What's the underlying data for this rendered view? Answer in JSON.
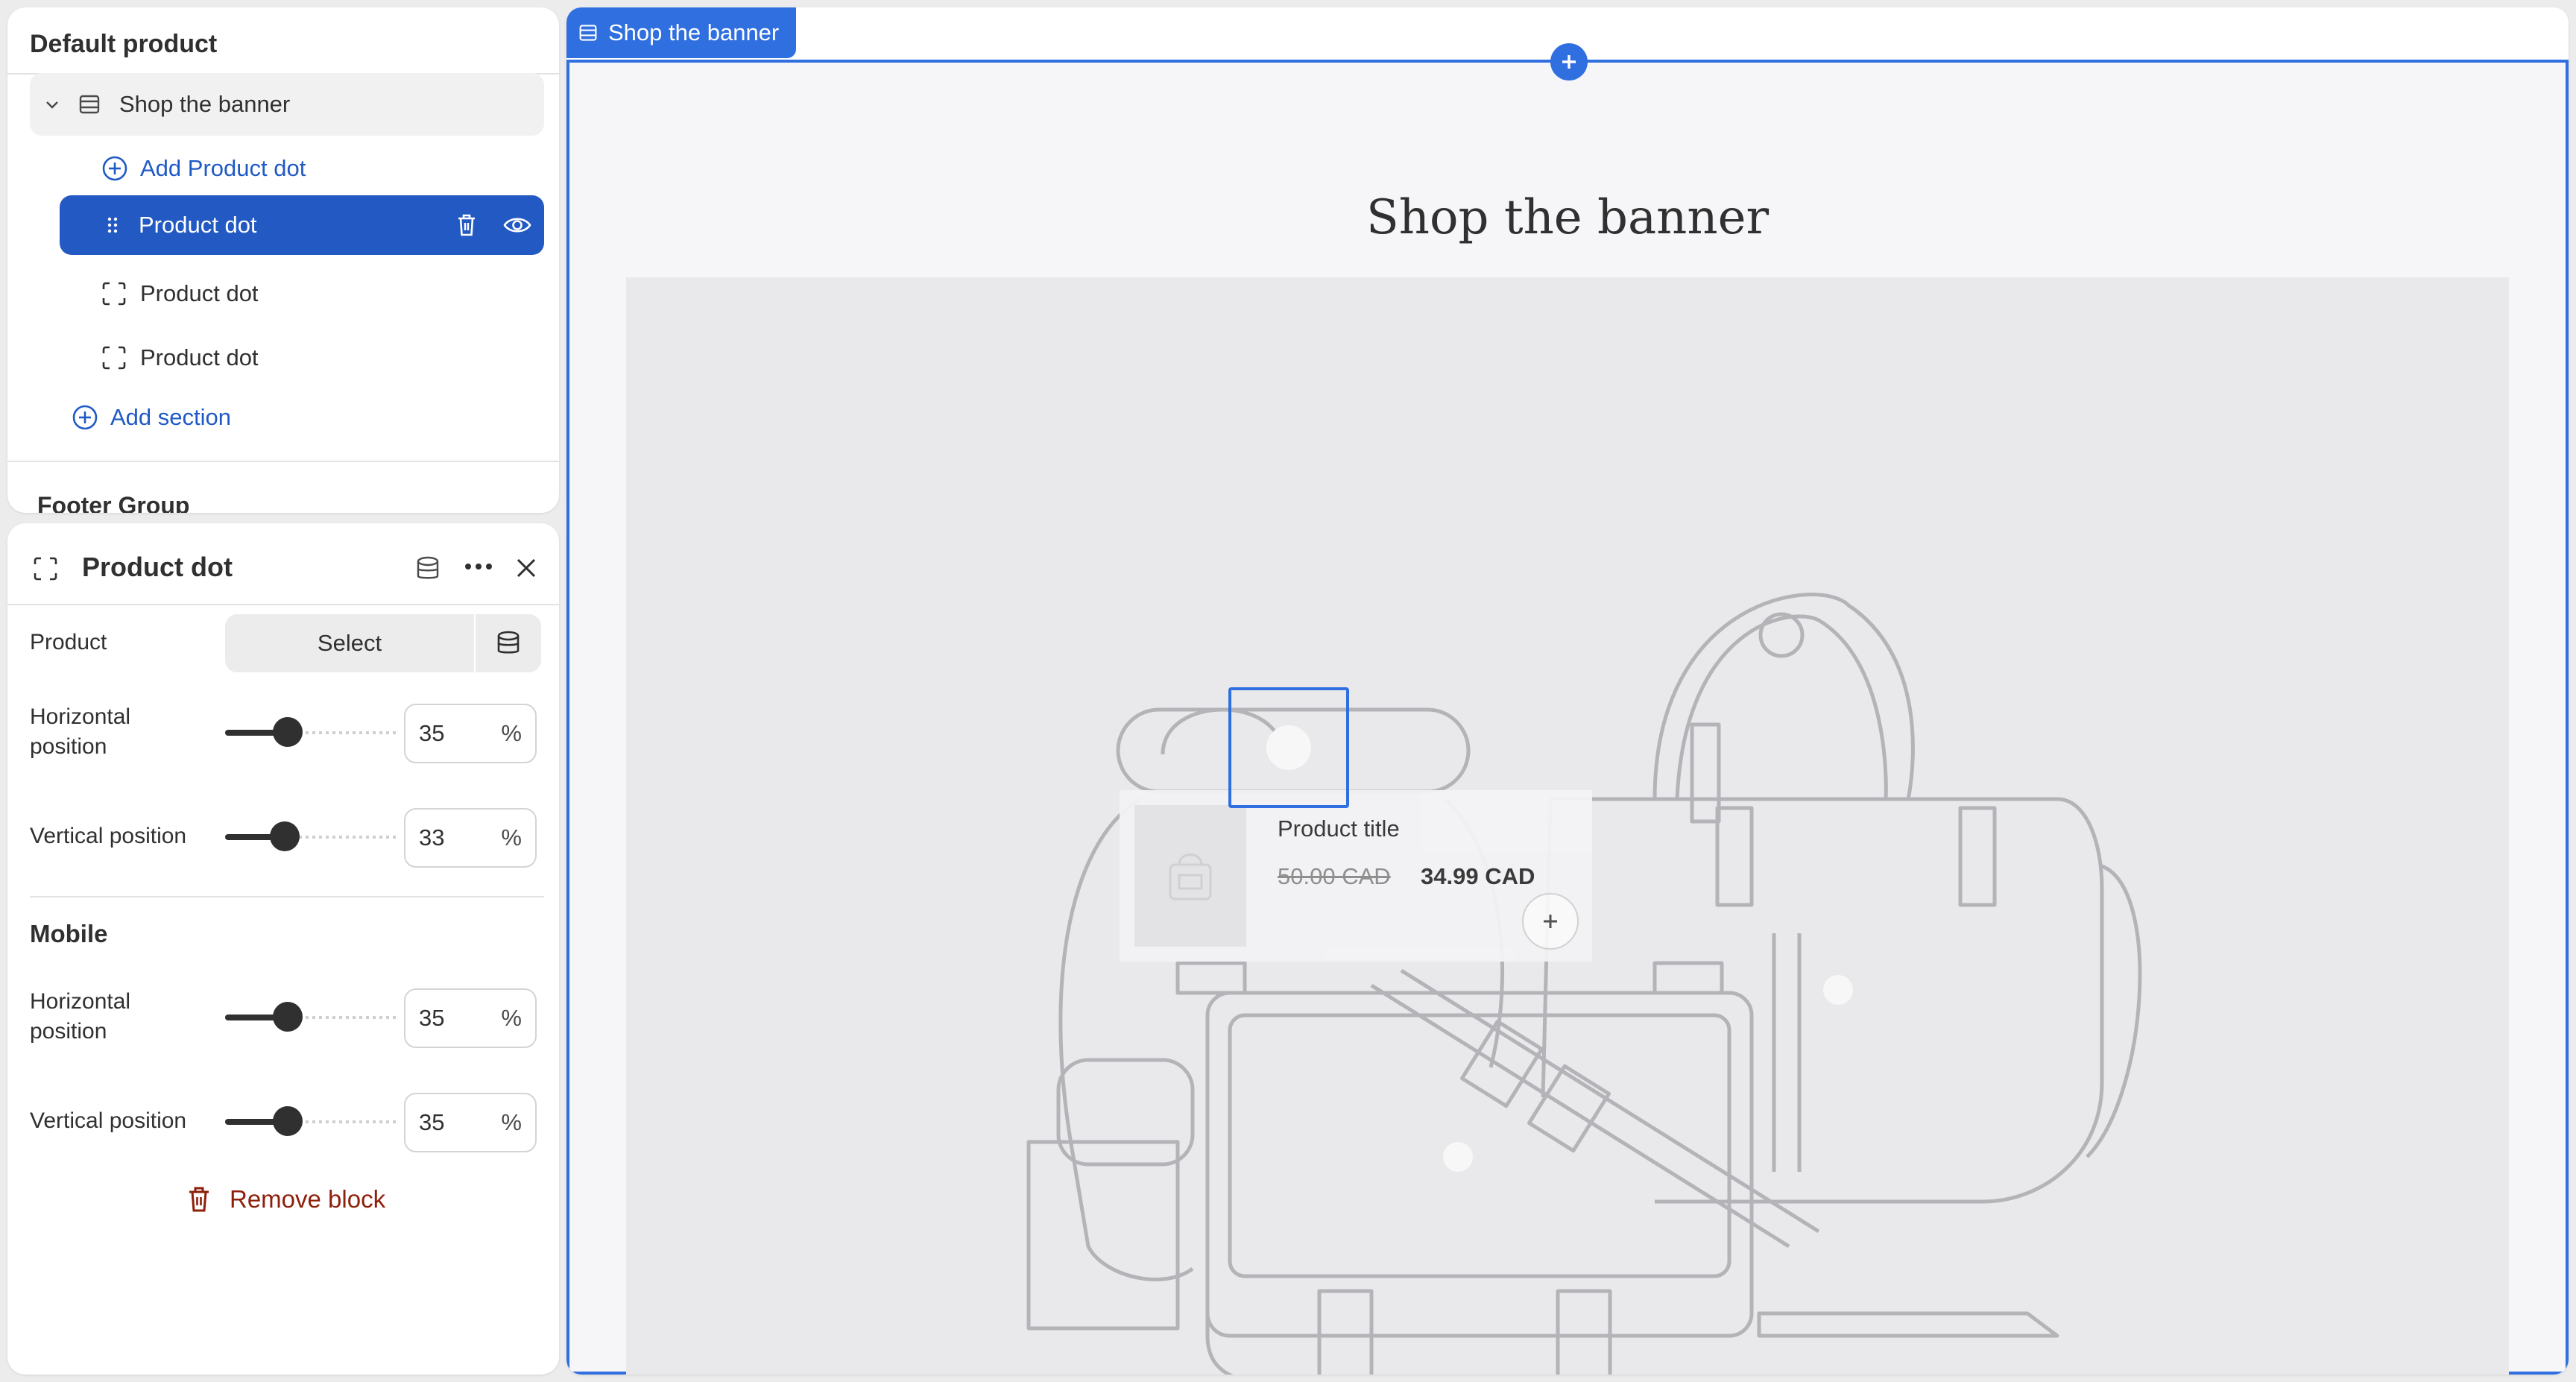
{
  "tree": {
    "title": "Default product",
    "section": "Shop the banner",
    "add_block": "Add Product dot",
    "blocks": [
      "Product dot",
      "Product dot",
      "Product dot"
    ],
    "add_section": "Add section",
    "footer_group": "Footer Group"
  },
  "settings": {
    "title": "Product dot",
    "product_label": "Product",
    "select_label": "Select",
    "desktop": {
      "horizontal_label": "Horizontal position",
      "horizontal_value": "35",
      "vertical_label": "Vertical position",
      "vertical_value": "33"
    },
    "mobile_title": "Mobile",
    "mobile": {
      "horizontal_label": "Horizontal position",
      "horizontal_value": "35",
      "vertical_label": "Vertical position",
      "vertical_value": "35"
    },
    "unit": "%",
    "remove_label": "Remove block"
  },
  "preview": {
    "tab_label": "Shop the banner",
    "heading": "Shop the banner",
    "card": {
      "title": "Product title",
      "price_old": "50.00 CAD",
      "price_new": "34.99 CAD"
    }
  },
  "colors": {
    "accent": "#2f6fe0",
    "selected_bg": "#2359c3",
    "link": "#1f5ac5",
    "danger": "#8e1f0b"
  },
  "icons": [
    "chevron-down-icon",
    "section-icon",
    "add-circle-icon",
    "drag-handle-icon",
    "trash-icon",
    "eye-icon",
    "block-dashed-icon",
    "database-icon",
    "more-icon",
    "close-icon",
    "plus-icon"
  ]
}
